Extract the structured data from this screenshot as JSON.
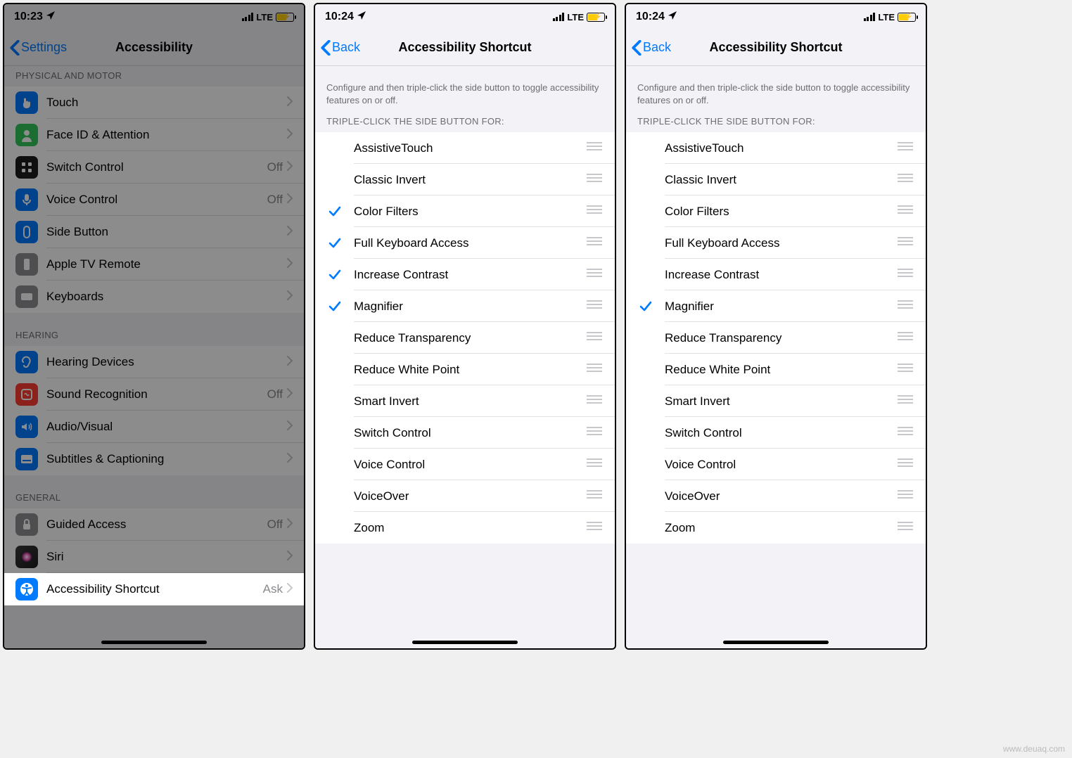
{
  "watermark": "www.deuaq.com",
  "screen1": {
    "status": {
      "time": "10:23",
      "network": "LTE"
    },
    "nav": {
      "back": "Settings",
      "title": "Accessibility"
    },
    "sections": {
      "physical_header": "PHYSICAL AND MOTOR",
      "hearing_header": "HEARING",
      "general_header": "GENERAL"
    },
    "rows": {
      "touch": "Touch",
      "faceid": "Face ID & Attention",
      "switch_control": "Switch Control",
      "switch_control_val": "Off",
      "voice_control": "Voice Control",
      "voice_control_val": "Off",
      "side_button": "Side Button",
      "appletv": "Apple TV Remote",
      "keyboards": "Keyboards",
      "hearing_devices": "Hearing Devices",
      "sound_recognition": "Sound Recognition",
      "sound_recognition_val": "Off",
      "audio_visual": "Audio/Visual",
      "subtitles": "Subtitles & Captioning",
      "guided_access": "Guided Access",
      "guided_access_val": "Off",
      "siri": "Siri",
      "accessibility_shortcut": "Accessibility Shortcut",
      "accessibility_shortcut_val": "Ask"
    }
  },
  "screen2": {
    "status": {
      "time": "10:24",
      "network": "LTE"
    },
    "nav": {
      "back": "Back",
      "title": "Accessibility Shortcut"
    },
    "desc": "Configure and then triple-click the side button to toggle accessibility features on or off.",
    "list_header": "TRIPLE-CLICK THE SIDE BUTTON FOR:",
    "items": [
      {
        "label": "AssistiveTouch",
        "checked": false
      },
      {
        "label": "Classic Invert",
        "checked": false
      },
      {
        "label": "Color Filters",
        "checked": true
      },
      {
        "label": "Full Keyboard Access",
        "checked": true
      },
      {
        "label": "Increase Contrast",
        "checked": true
      },
      {
        "label": "Magnifier",
        "checked": true
      },
      {
        "label": "Reduce Transparency",
        "checked": false
      },
      {
        "label": "Reduce White Point",
        "checked": false
      },
      {
        "label": "Smart Invert",
        "checked": false
      },
      {
        "label": "Switch Control",
        "checked": false
      },
      {
        "label": "Voice Control",
        "checked": false
      },
      {
        "label": "VoiceOver",
        "checked": false
      },
      {
        "label": "Zoom",
        "checked": false
      }
    ]
  },
  "screen3": {
    "status": {
      "time": "10:24",
      "network": "LTE"
    },
    "nav": {
      "back": "Back",
      "title": "Accessibility Shortcut"
    },
    "desc": "Configure and then triple-click the side button to toggle accessibility features on or off.",
    "list_header": "TRIPLE-CLICK THE SIDE BUTTON FOR:",
    "items": [
      {
        "label": "AssistiveTouch",
        "checked": false
      },
      {
        "label": "Classic Invert",
        "checked": false
      },
      {
        "label": "Color Filters",
        "checked": false
      },
      {
        "label": "Full Keyboard Access",
        "checked": false
      },
      {
        "label": "Increase Contrast",
        "checked": false
      },
      {
        "label": "Magnifier",
        "checked": true
      },
      {
        "label": "Reduce Transparency",
        "checked": false
      },
      {
        "label": "Reduce White Point",
        "checked": false
      },
      {
        "label": "Smart Invert",
        "checked": false
      },
      {
        "label": "Switch Control",
        "checked": false
      },
      {
        "label": "Voice Control",
        "checked": false
      },
      {
        "label": "VoiceOver",
        "checked": false
      },
      {
        "label": "Zoom",
        "checked": false
      }
    ]
  }
}
